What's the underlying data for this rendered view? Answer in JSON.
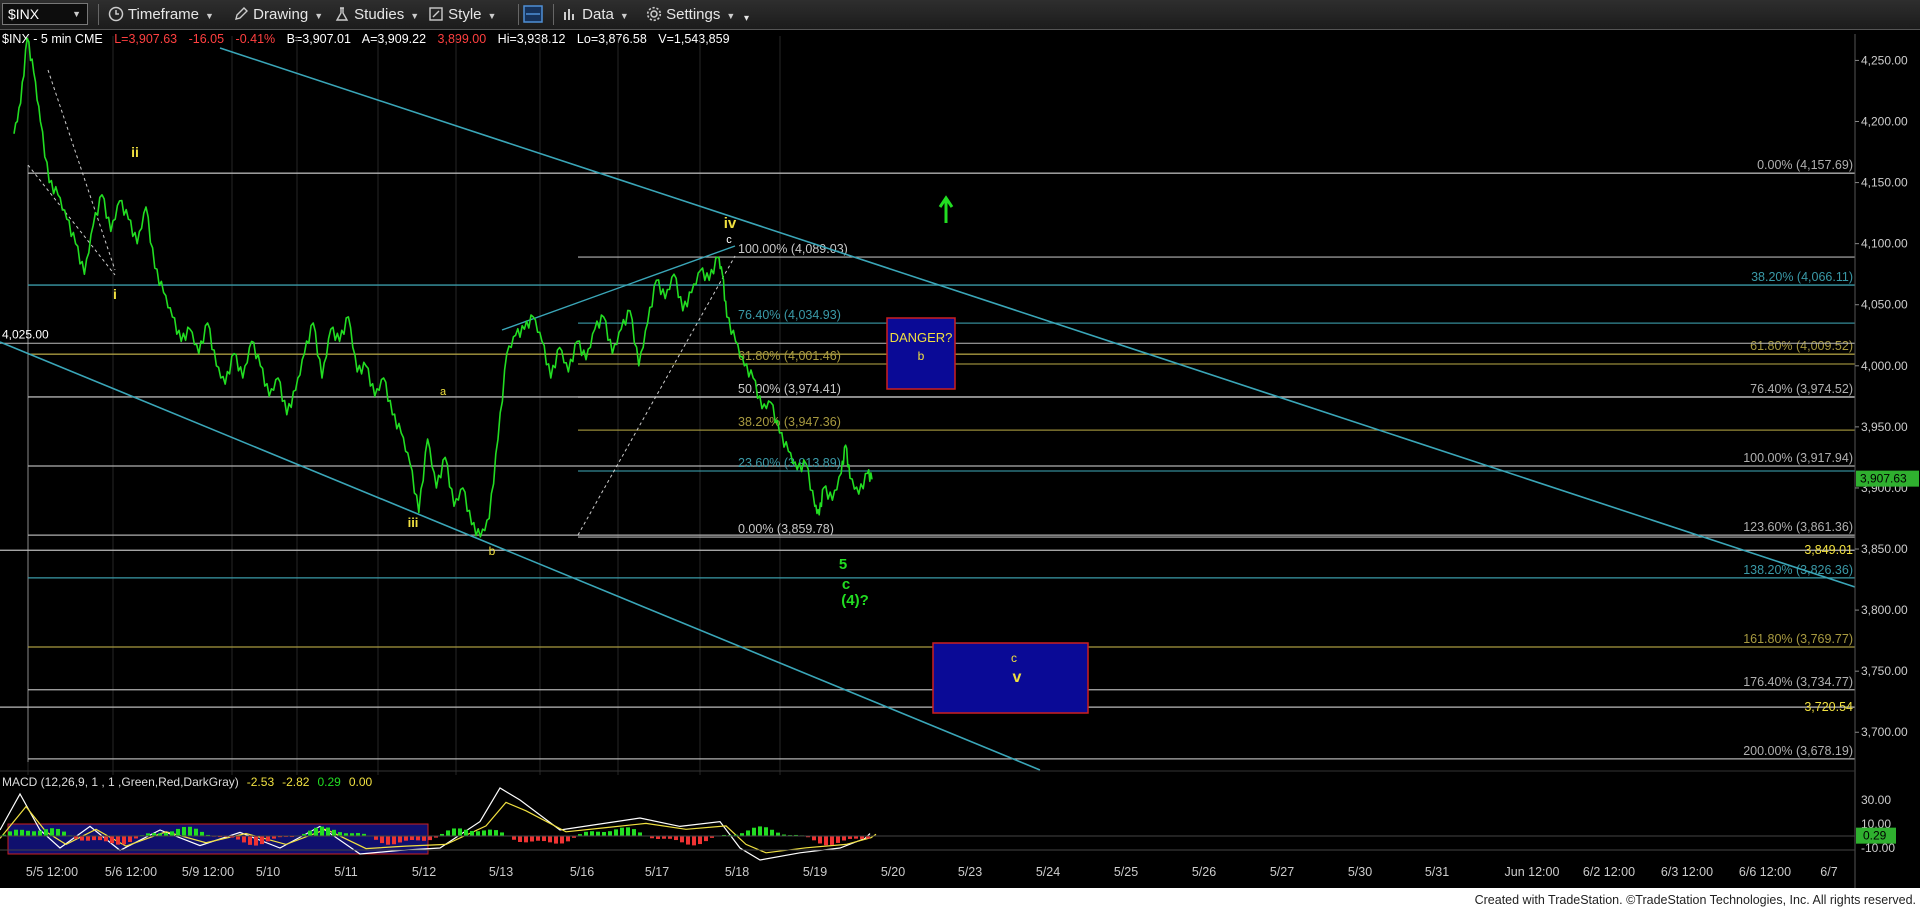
{
  "toolbar": {
    "symbol": "$INX",
    "timeframe": "Timeframe",
    "drawing": "Drawing",
    "studies": "Studies",
    "style": "Style",
    "data": "Data",
    "settings": "Settings"
  },
  "header": {
    "symbol_label": "$INX - 5 min  CME",
    "last": "L=3,907.63",
    "change": "-16.05",
    "change_pct": "-0.41%",
    "bid": "B=3,907.01",
    "ask": "A=3,909.22",
    "open": "3,899.00",
    "high": "Hi=3,938.12",
    "low": "Lo=3,876.58",
    "volume": "V=1,543,859"
  },
  "colors": {
    "background": "#000000",
    "price": "#22dd22",
    "trendline": "#3aa6b8",
    "wave_label_yellow": "#f0e040",
    "wave_label_green": "#22dd22",
    "box_fill": "#0a0a96",
    "box_border": "#cc2020",
    "macd_line": "#22dd22",
    "macd_signal": "#ee3333",
    "macd_hist": "#888888"
  },
  "chart_data": {
    "type": "line",
    "title": "$INX - 5 min",
    "price_axis": {
      "ticks": [
        "4,250.00",
        "4,200.00",
        "4,150.00",
        "4,100.00",
        "4,050.00",
        "4,000.00",
        "3,950.00",
        "3,900.00",
        "3,850.00",
        "3,800.00",
        "3,750.00",
        "3,700.00"
      ],
      "ylim": [
        3665,
        4270
      ],
      "current_price": "3,907.63",
      "highlight_level": "3,849.01",
      "highlight_level2": "3,720.54"
    },
    "date_axis": [
      "5/5 12:00",
      "5/6 12:00",
      "5/9 12:00",
      "5/10",
      "5/11",
      "5/12",
      "5/13",
      "5/16",
      "5/17",
      "5/18",
      "5/19",
      "5/20",
      "5/23",
      "5/24",
      "5/25",
      "5/26",
      "5/27",
      "5/30",
      "5/31",
      "Jun 12:00",
      "6/2 12:00",
      "6/3 12:00",
      "6/6 12:00",
      "6/7"
    ],
    "price_series": [
      {
        "i": 0,
        "v": 4190
      },
      {
        "i": 3,
        "v": 4215
      },
      {
        "i": 6,
        "v": 4268
      },
      {
        "i": 9,
        "v": 4240
      },
      {
        "i": 12,
        "v": 4200
      },
      {
        "i": 16,
        "v": 4150
      },
      {
        "i": 20,
        "v": 4140
      },
      {
        "i": 24,
        "v": 4120
      },
      {
        "i": 28,
        "v": 4100
      },
      {
        "i": 32,
        "v": 4075
      },
      {
        "i": 36,
        "v": 4115
      },
      {
        "i": 40,
        "v": 4140
      },
      {
        "i": 44,
        "v": 4110
      },
      {
        "i": 48,
        "v": 4135
      },
      {
        "i": 52,
        "v": 4120
      },
      {
        "i": 56,
        "v": 4100
      },
      {
        "i": 60,
        "v": 4130
      },
      {
        "i": 64,
        "v": 4080
      },
      {
        "i": 68,
        "v": 4060
      },
      {
        "i": 72,
        "v": 4040
      },
      {
        "i": 76,
        "v": 4020
      },
      {
        "i": 80,
        "v": 4030
      },
      {
        "i": 84,
        "v": 4010
      },
      {
        "i": 88,
        "v": 4035
      },
      {
        "i": 92,
        "v": 4000
      },
      {
        "i": 96,
        "v": 3985
      },
      {
        "i": 100,
        "v": 4010
      },
      {
        "i": 104,
        "v": 3990
      },
      {
        "i": 108,
        "v": 4020
      },
      {
        "i": 112,
        "v": 4000
      },
      {
        "i": 116,
        "v": 3975
      },
      {
        "i": 120,
        "v": 3990
      },
      {
        "i": 124,
        "v": 3960
      },
      {
        "i": 128,
        "v": 3980
      },
      {
        "i": 132,
        "v": 4010
      },
      {
        "i": 136,
        "v": 4035
      },
      {
        "i": 140,
        "v": 3990
      },
      {
        "i": 144,
        "v": 4030
      },
      {
        "i": 148,
        "v": 4020
      },
      {
        "i": 152,
        "v": 4040
      },
      {
        "i": 156,
        "v": 3995
      },
      {
        "i": 160,
        "v": 4000
      },
      {
        "i": 164,
        "v": 3975
      },
      {
        "i": 168,
        "v": 3990
      },
      {
        "i": 172,
        "v": 3960
      },
      {
        "i": 176,
        "v": 3945
      },
      {
        "i": 180,
        "v": 3920
      },
      {
        "i": 184,
        "v": 3880
      },
      {
        "i": 188,
        "v": 3940
      },
      {
        "i": 192,
        "v": 3900
      },
      {
        "i": 196,
        "v": 3925
      },
      {
        "i": 200,
        "v": 3885
      },
      {
        "i": 204,
        "v": 3900
      },
      {
        "i": 208,
        "v": 3870
      },
      {
        "i": 212,
        "v": 3860
      },
      {
        "i": 216,
        "v": 3875
      },
      {
        "i": 220,
        "v": 3940
      },
      {
        "i": 224,
        "v": 4010
      },
      {
        "i": 228,
        "v": 4025
      },
      {
        "i": 232,
        "v": 4030
      },
      {
        "i": 236,
        "v": 4040
      },
      {
        "i": 240,
        "v": 4020
      },
      {
        "i": 244,
        "v": 3990
      },
      {
        "i": 248,
        "v": 4015
      },
      {
        "i": 252,
        "v": 3995
      },
      {
        "i": 256,
        "v": 4020
      },
      {
        "i": 260,
        "v": 4005
      },
      {
        "i": 264,
        "v": 4030
      },
      {
        "i": 268,
        "v": 4040
      },
      {
        "i": 272,
        "v": 4010
      },
      {
        "i": 276,
        "v": 4030
      },
      {
        "i": 280,
        "v": 4045
      },
      {
        "i": 284,
        "v": 4000
      },
      {
        "i": 288,
        "v": 4035
      },
      {
        "i": 292,
        "v": 4070
      },
      {
        "i": 296,
        "v": 4055
      },
      {
        "i": 300,
        "v": 4075
      },
      {
        "i": 304,
        "v": 4045
      },
      {
        "i": 308,
        "v": 4060
      },
      {
        "i": 312,
        "v": 4078
      },
      {
        "i": 316,
        "v": 4070
      },
      {
        "i": 320,
        "v": 4089
      },
      {
        "i": 322,
        "v": 4075
      },
      {
        "i": 324,
        "v": 4040
      },
      {
        "i": 328,
        "v": 4020
      },
      {
        "i": 332,
        "v": 4000
      },
      {
        "i": 336,
        "v": 3990
      },
      {
        "i": 340,
        "v": 3965
      },
      {
        "i": 344,
        "v": 3970
      },
      {
        "i": 348,
        "v": 3945
      },
      {
        "i": 352,
        "v": 3930
      },
      {
        "i": 356,
        "v": 3915
      },
      {
        "i": 360,
        "v": 3920
      },
      {
        "i": 364,
        "v": 3885
      },
      {
        "i": 366,
        "v": 3878
      },
      {
        "i": 368,
        "v": 3900
      },
      {
        "i": 372,
        "v": 3890
      },
      {
        "i": 376,
        "v": 3912
      },
      {
        "i": 378,
        "v": 3935
      },
      {
        "i": 380,
        "v": 3908
      },
      {
        "i": 384,
        "v": 3895
      },
      {
        "i": 388,
        "v": 3912
      },
      {
        "i": 390,
        "v": 3907
      }
    ],
    "horizontal_levels": [
      {
        "label": "0.00% (4,157.69)",
        "value": 4157.69,
        "color": "#b0b0b0"
      },
      {
        "label": "38.20% (4,066.11)",
        "value": 4066.11,
        "color": "#3a9aa8"
      },
      {
        "label": "61.80% (4,009.52)",
        "value": 4009.52,
        "color": "#a89a40"
      },
      {
        "label": "76.40% (3,974.52)",
        "value": 3974.52,
        "color": "#b0b0b0"
      },
      {
        "label": "100.00% (3,917.94)",
        "value": 3917.94,
        "color": "#b0b0b0"
      },
      {
        "label": "123.60% (3,861.36)",
        "value": 3861.36,
        "color": "#b0b0b0"
      },
      {
        "label": "138.20% (3,826.36)",
        "value": 3826.36,
        "color": "#3a9aa8"
      },
      {
        "label": "161.80% (3,769.77)",
        "value": 3769.77,
        "color": "#a89a40"
      },
      {
        "label": "176.40% (3,734.77)",
        "value": 3734.77,
        "color": "#b0b0b0"
      },
      {
        "label": "200.00% (3,678.19)",
        "value": 3678.19,
        "color": "#b0b0b0"
      }
    ],
    "short_levels": [
      {
        "label": "100.00% (4,089.03)",
        "value": 4089.03,
        "color": "#c8c8c8"
      },
      {
        "label": "76.40% (4,034.93)",
        "value": 4034.93,
        "color": "#3a9aa8"
      },
      {
        "label": "61.80% (4,001.46)",
        "value": 4001.46,
        "color": "#a89a40"
      },
      {
        "label": "50.00% (3,974.41)",
        "value": 3974.41,
        "color": "#c8c8c8"
      },
      {
        "label": "38.20% (3,947.36)",
        "value": 3947.36,
        "color": "#a89a40"
      },
      {
        "label": "23.60% (3,913.89)",
        "value": 3913.89,
        "color": "#3a9aa8"
      },
      {
        "label": "0.00% (3,859.78)",
        "value": 3859.78,
        "color": "#c8c8c8"
      }
    ],
    "extra_levels": [
      {
        "label": "4,025.00",
        "value": 4025.0
      },
      {
        "label": "3,849.01",
        "value": 3849.01
      },
      {
        "label": "3,720.54",
        "value": 3720.54
      }
    ],
    "wave_labels": [
      {
        "text": "ii",
        "color": "yellow"
      },
      {
        "text": "i",
        "color": "yellow"
      },
      {
        "text": "iv",
        "color": "yellow"
      },
      {
        "text": "c",
        "color": "white"
      },
      {
        "text": "a",
        "color": "yellow"
      },
      {
        "text": "iii",
        "color": "yellow"
      },
      {
        "text": "b",
        "color": "yellow"
      },
      {
        "text": "5",
        "color": "green"
      },
      {
        "text": "c",
        "color": "green"
      },
      {
        "text": "(4)?",
        "color": "green"
      },
      {
        "text": "c",
        "color": "yellow"
      },
      {
        "text": "v",
        "color": "yellow"
      }
    ],
    "boxes": [
      {
        "label": "DANGER?",
        "sublabel": "b"
      },
      {
        "label": "c",
        "sublabel": "v"
      }
    ]
  },
  "macd": {
    "label": "MACD (12,26,9, 1 , 1 ,Green,Red,DarkGray)",
    "v1": "-2.53",
    "v2": "-2.82",
    "v3": "0.29",
    "v4": "0.00",
    "axis_ticks": [
      "30.00",
      "10.00",
      "0.29",
      "-10.00"
    ]
  },
  "footer": {
    "credit": "Created with TradeStation. ©TradeStation Technologies, Inc. All rights reserved."
  }
}
